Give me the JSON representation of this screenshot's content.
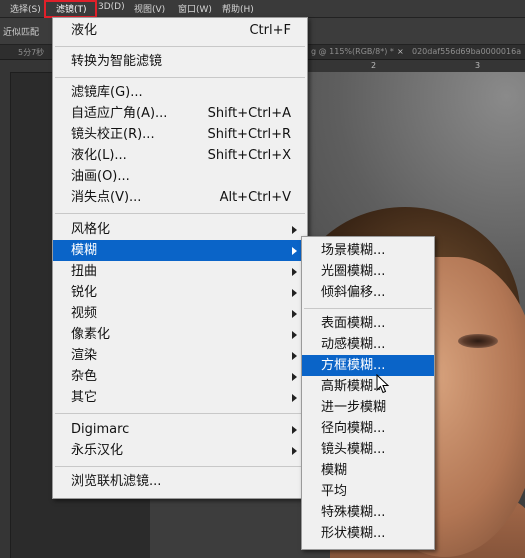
{
  "menubar": {
    "items": [
      "选择(S)",
      "滤镜(T)",
      "3D(D)",
      "视图(V)",
      "窗口(W)",
      "帮助(H)"
    ]
  },
  "options_bar": {
    "label": "近似匹配"
  },
  "tabbar": {
    "left_label": "5分7秒",
    "doc_tab": "g @ 115%(RGB/8*) *",
    "close": "×",
    "right_tab": "020daf556d69ba0000016a"
  },
  "ruler": {
    "marks": [
      "2",
      "3"
    ]
  },
  "filter_menu": {
    "items": [
      {
        "label": "液化",
        "shortcut": "Ctrl+F"
      },
      {
        "label": "转换为智能滤镜",
        "shortcut": ""
      },
      {
        "label": "滤镜库(G)...",
        "shortcut": ""
      },
      {
        "label": "自适应广角(A)...",
        "shortcut": "Shift+Ctrl+A"
      },
      {
        "label": "镜头校正(R)...",
        "shortcut": "Shift+Ctrl+R"
      },
      {
        "label": "液化(L)...",
        "shortcut": "Shift+Ctrl+X"
      },
      {
        "label": "油画(O)...",
        "shortcut": ""
      },
      {
        "label": "消失点(V)...",
        "shortcut": "Alt+Ctrl+V"
      },
      {
        "label": "风格化",
        "shortcut": ""
      },
      {
        "label": "模糊",
        "shortcut": ""
      },
      {
        "label": "扭曲",
        "shortcut": ""
      },
      {
        "label": "锐化",
        "shortcut": ""
      },
      {
        "label": "视频",
        "shortcut": ""
      },
      {
        "label": "像素化",
        "shortcut": ""
      },
      {
        "label": "渲染",
        "shortcut": ""
      },
      {
        "label": "杂色",
        "shortcut": ""
      },
      {
        "label": "其它",
        "shortcut": ""
      },
      {
        "label": "Digimarc",
        "shortcut": ""
      },
      {
        "label": "永乐汉化",
        "shortcut": ""
      },
      {
        "label": "浏览联机滤镜...",
        "shortcut": ""
      }
    ]
  },
  "blur_submenu": {
    "items": [
      {
        "label": "场景模糊..."
      },
      {
        "label": "光圈模糊..."
      },
      {
        "label": "倾斜偏移..."
      },
      {
        "label": "表面模糊..."
      },
      {
        "label": "动感模糊..."
      },
      {
        "label": "方框模糊..."
      },
      {
        "label": "高斯模糊..."
      },
      {
        "label": "进一步模糊"
      },
      {
        "label": "径向模糊..."
      },
      {
        "label": "镜头模糊..."
      },
      {
        "label": "模糊"
      },
      {
        "label": "平均"
      },
      {
        "label": "特殊模糊..."
      },
      {
        "label": "形状模糊..."
      }
    ]
  },
  "colors": {
    "highlight": "#0a64c8",
    "menu_bg": "#f0f0f0",
    "annotation": "#e0202a"
  }
}
